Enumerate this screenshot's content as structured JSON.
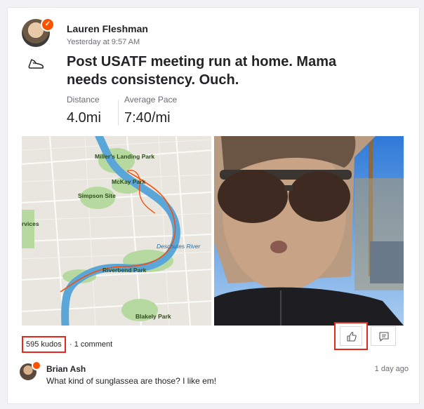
{
  "activity": {
    "athlete_name": "Lauren Fleshman",
    "timestamp": "Yesterday at 9:57 AM",
    "badge_symbol": "✓",
    "sport_icon": "running-shoe-icon",
    "title": "Post USATF meeting run at home. Mama needs consistency. Ouch.",
    "stats": [
      {
        "label": "Distance",
        "value": "4.0mi"
      },
      {
        "label": "Average Pace",
        "value": "7:40/mi"
      }
    ]
  },
  "map": {
    "labels": [
      "Miller's Landing Park",
      "McKay Park",
      "Simpson Site",
      "rvices",
      "Deschutes River",
      "Riverbend Park",
      "Blakely Park"
    ]
  },
  "social": {
    "kudos": "595 kudos",
    "separator": "·",
    "comments": "1 comment",
    "kudo_icon": "thumbs-up-icon",
    "comment_icon": "comment-icon"
  },
  "comment": {
    "author": "Brian Ash",
    "text": "What kind of sunglassea are those? I like em!",
    "time": "1 day ago"
  },
  "colors": {
    "brand": "#fc5200",
    "highlight": "#e8271a",
    "route": "#fc4c02",
    "river": "#5aa6d8",
    "park": "#b6d9a0"
  }
}
